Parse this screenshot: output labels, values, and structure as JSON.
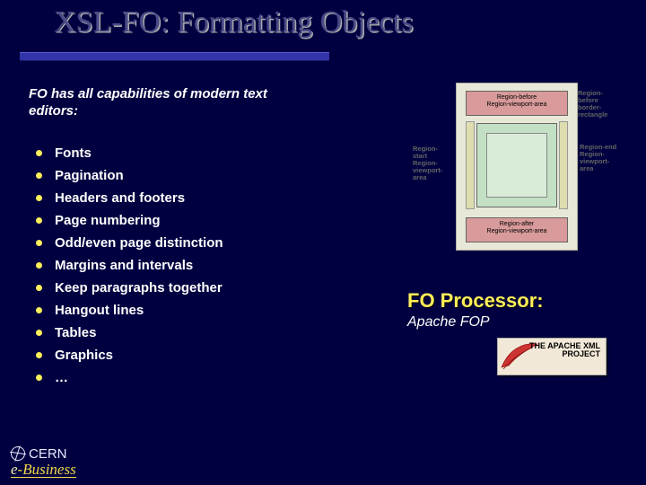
{
  "title": "XSL-FO: Formatting Objects",
  "intro": "FO has all capabilities of modern text editors:",
  "bullets": [
    "Fonts",
    "Pagination",
    "Headers and footers",
    "Page numbering",
    "Odd/even page distinction",
    "Margins and intervals",
    "Keep paragraphs together",
    "Hangout lines",
    "Tables",
    "Graphics",
    "…"
  ],
  "diagram": {
    "top_label": "Region-before\nRegion-viewport-area",
    "bottom_label": "Region-after\nRegion-viewport-area",
    "left_anno": "Region-start\nRegion-viewport-area",
    "right_anno": "Region-end\nRegion-viewport-area",
    "rtop_anno": "Region-before\nborder-rectangle"
  },
  "foproc": {
    "heading": "FO Processor:",
    "sub": "Apache FOP",
    "logo_text": "THE APACHE XML\nPROJECT"
  },
  "footer": {
    "org": "CERN",
    "sub": "e-Business"
  }
}
